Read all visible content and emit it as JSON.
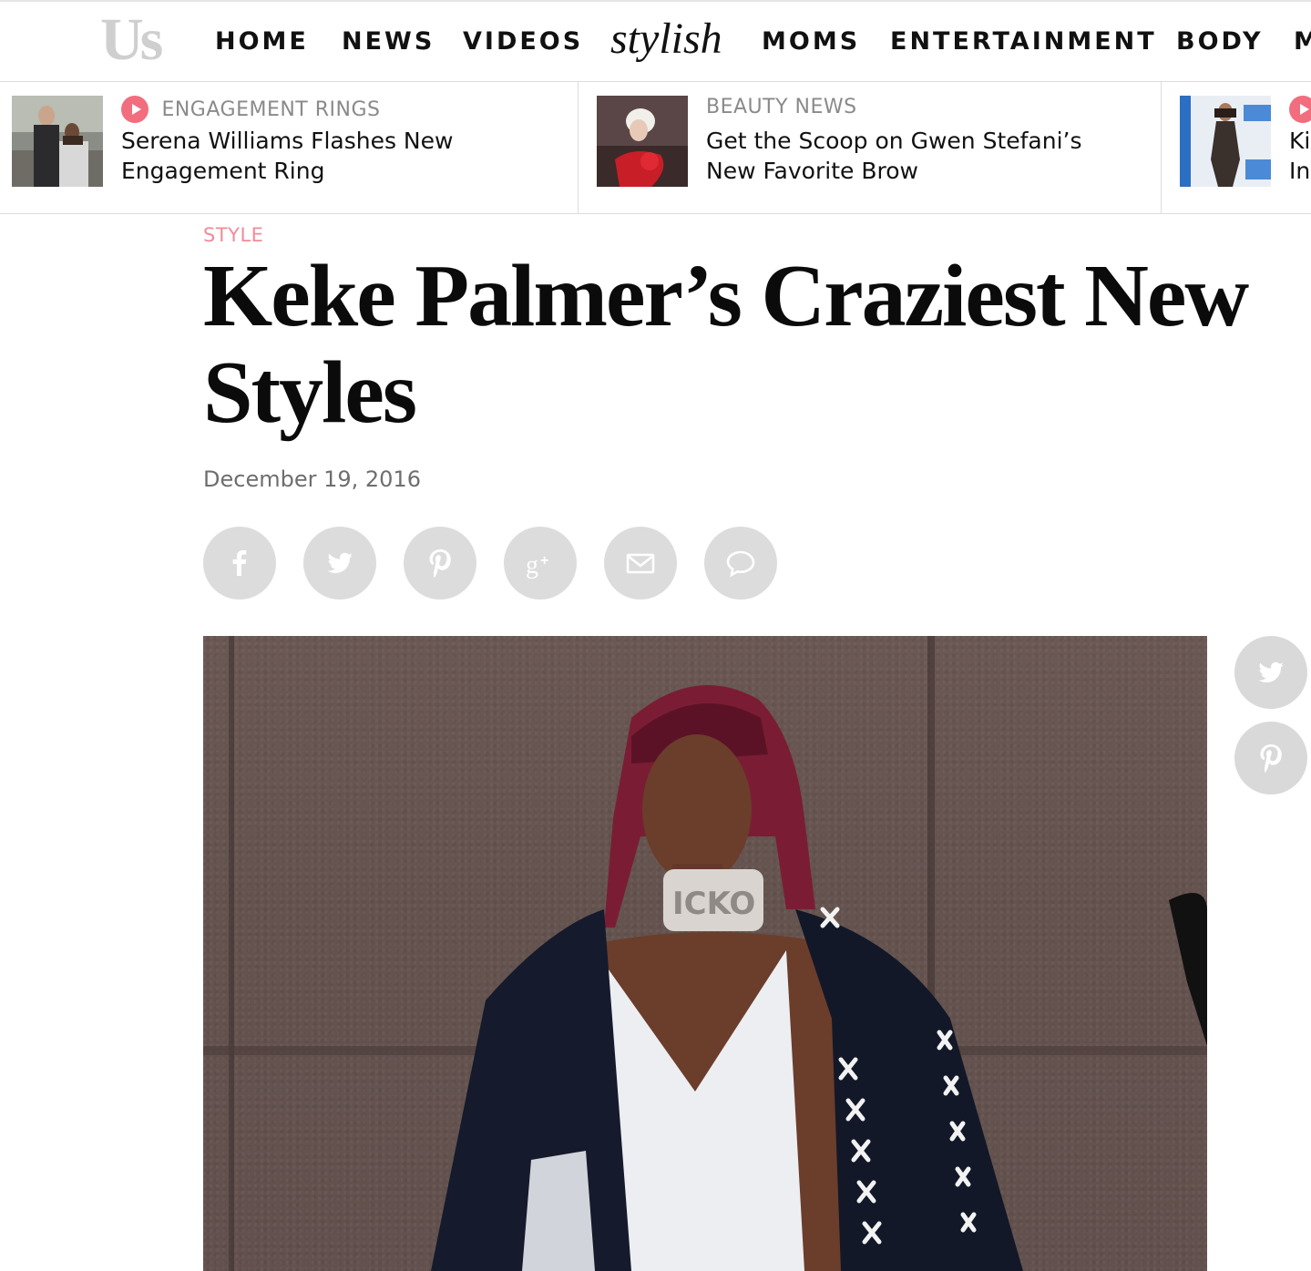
{
  "nav": {
    "logo": "Us",
    "items": [
      {
        "label": "HOME"
      },
      {
        "label": "NEWS"
      },
      {
        "label": "VIDEOS"
      },
      {
        "label": "stylish"
      },
      {
        "label": "MOMS"
      },
      {
        "label": "ENTERTAINMENT"
      },
      {
        "label": "BODY"
      },
      {
        "label": "M"
      }
    ]
  },
  "trending": [
    {
      "category": "ENGAGEMENT RINGS",
      "title": "Serena Williams Flashes New Engagement Ring",
      "has_play_icon": true
    },
    {
      "category": "BEAUTY NEWS",
      "title": "Get the Scoop on Gwen Stefani’s New Favorite Brow",
      "has_play_icon": false
    },
    {
      "category": "",
      "title": "Ki In",
      "has_play_icon": true
    }
  ],
  "article": {
    "section": "STYLE",
    "headline": "Keke Palmer’s Craziest New Styles",
    "date": "December 19, 2016"
  },
  "share_buttons": [
    {
      "icon": "facebook-icon"
    },
    {
      "icon": "twitter-icon"
    },
    {
      "icon": "pinterest-icon"
    },
    {
      "icon": "google-plus-icon"
    },
    {
      "icon": "email-icon"
    },
    {
      "icon": "comment-icon"
    }
  ],
  "side_share": [
    {
      "icon": "twitter-icon"
    },
    {
      "icon": "pinterest-icon"
    }
  ],
  "colors": {
    "accent_pink": "#f26d7d",
    "section_pink": "#f28b99",
    "share_gray": "#dcdcdc",
    "logo_gray": "#cfcfcf"
  }
}
